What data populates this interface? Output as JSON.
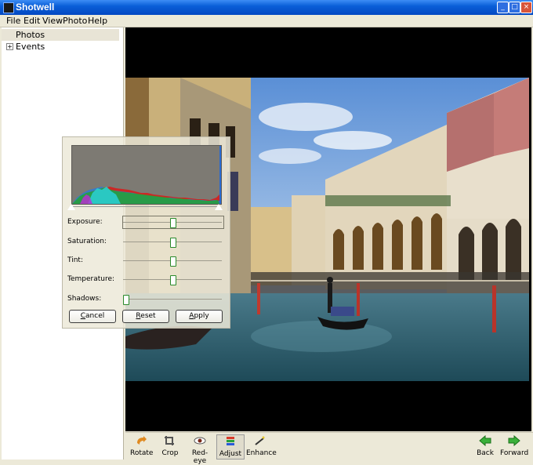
{
  "window": {
    "title": "Shotwell"
  },
  "menu": [
    "File",
    "Edit",
    "View",
    "Photo",
    "Help"
  ],
  "sidebar": {
    "items": [
      {
        "label": "Photos",
        "selected": true
      },
      {
        "label": "Events",
        "expander": "+"
      }
    ]
  },
  "adjust": {
    "sliders": [
      {
        "label": "Exposure:",
        "value": 0.5,
        "focused": true
      },
      {
        "label": "Saturation:",
        "value": 0.5
      },
      {
        "label": "Tint:",
        "value": 0.5
      },
      {
        "label": "Temperature:",
        "value": 0.5
      },
      {
        "label": "Shadows:",
        "value": 0.0
      }
    ],
    "buttons": [
      {
        "label": "Cancel",
        "mnemonic": "C"
      },
      {
        "label": "Reset",
        "mnemonic": "R"
      },
      {
        "label": "Apply",
        "mnemonic": "A"
      }
    ]
  },
  "toolbar": {
    "rotate": "Rotate",
    "crop": "Crop",
    "redeye": "Red-eye",
    "adjust": "Adjust",
    "enhance": "Enhance",
    "back": "Back",
    "forward": "Forward"
  },
  "colors": {
    "titlebar": "#0a5fd8",
    "sidebar_selected": "#e8e4d6",
    "viewer_bg": "#000000",
    "thumb_border": "#2a8a2a"
  }
}
